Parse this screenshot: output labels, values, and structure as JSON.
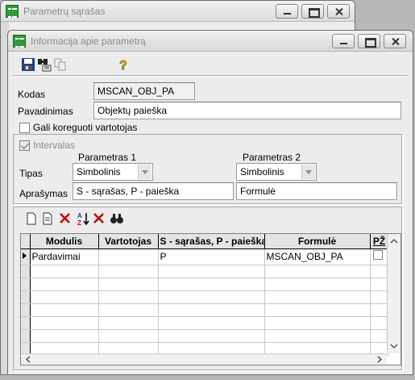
{
  "back_window": {
    "title": "Parametrų sąrašas"
  },
  "front_window": {
    "title": "Informacija apie parametrą"
  },
  "toolbar": {
    "icons": [
      "save-icon",
      "binoculars-select-icon",
      "copy-icon",
      "help-icon"
    ]
  },
  "form": {
    "kodas_label": "Kodas",
    "kodas_value": "MSCAN_OBJ_PA",
    "pavadinimas_label": "Pavadinimas",
    "pavadinimas_value": "Objektų paieška",
    "gali_koreguoti_label": "Gali koreguoti vartotojas",
    "gali_koreguoti_checked": false,
    "intervalas_label": "Intervalas",
    "intervalas_checked": true,
    "param1_header": "Parametras 1",
    "param2_header": "Parametras 2",
    "tipas_label": "Tipas",
    "tipas1_value": "Simbolinis",
    "tipas2_value": "Simbolinis",
    "aprasymas_label": "Aprašymas",
    "aprasymas1_value": "S - sąrašas, P - paieška",
    "aprasymas2_value": "Formulė"
  },
  "grid_toolbar": {
    "icons": [
      "new-icon",
      "edit-icon",
      "delete-icon",
      "sort-az-icon",
      "clear-filter-icon",
      "find-icon"
    ]
  },
  "grid": {
    "columns": [
      "Modulis",
      "Vartotojas",
      "S - sąrašas, P - paieška",
      "Formulė",
      "PŽ"
    ],
    "rows": [
      {
        "modulis": "Pardavimai",
        "vartotojas": "",
        "s_p": "P",
        "formule": "MSCAN_OBJ_PA",
        "pz_checked": false
      }
    ]
  },
  "colors": {
    "window_bg": "#ececec",
    "title_text_inactive": "#8a8a8a",
    "title_icon_green": "#2f9a3b",
    "delete_red": "#cc0000"
  }
}
